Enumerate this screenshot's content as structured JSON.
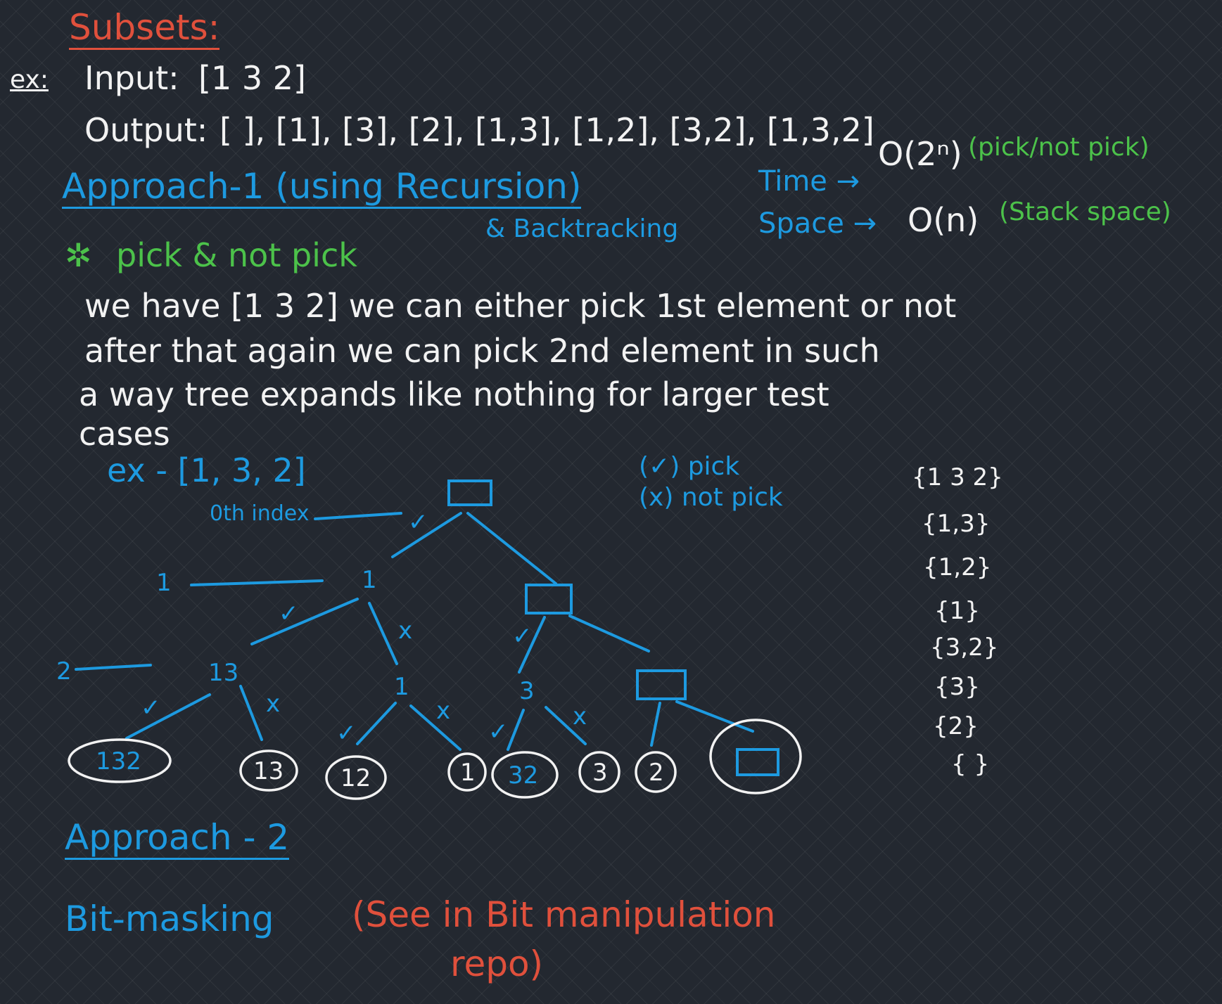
{
  "title": "Subsets:",
  "example": {
    "tag": "ex:",
    "input_label": "Input:",
    "input_value": "[1 3 2]",
    "output_label": "Output:",
    "output_value": "[ ], [1], [3], [2], [1,3], [1,2], [3,2], [1,3,2]"
  },
  "approach1": {
    "title": "Approach-1 (using Recursion)",
    "subtitle": "& Backtracking",
    "time_label": "Time →",
    "time_value": "O(2ⁿ)",
    "time_note": "(pick/not pick)",
    "space_label": "Space →",
    "space_value": "O(n)",
    "space_note": "(Stack space)",
    "bullet_mark": "✲",
    "bullet": "pick & not pick",
    "explanation": [
      "we have [1 3 2]   we can either pick 1st element or not",
      "after that again we can pick 2nd element in such",
      "a way  tree expands like nothing for larger test",
      "cases"
    ]
  },
  "tree": {
    "example": "ex - [1, 3, 2]",
    "legend_pick": "(✓) pick",
    "legend_not_pick": "(x) not pick",
    "index_label": "0th index",
    "level1_index": "1",
    "level2_index": "2",
    "node_1": "1",
    "node_13": "13",
    "node_1b": "1",
    "node_3": "3",
    "pick_mark": "✓",
    "not_pick_mark": "x",
    "leaves": [
      "132",
      "13",
      "12",
      "1",
      "32",
      "3",
      "2",
      ""
    ]
  },
  "results": [
    "{1 3 2}",
    "{1,3}",
    "{1,2}",
    "{1}",
    "{3,2}",
    "{3}",
    "{2}",
    "{ }"
  ],
  "approach2": {
    "title": "Approach - 2",
    "method": "Bit-masking",
    "note": "(See in Bit manipulation",
    "note2": "repo)"
  }
}
